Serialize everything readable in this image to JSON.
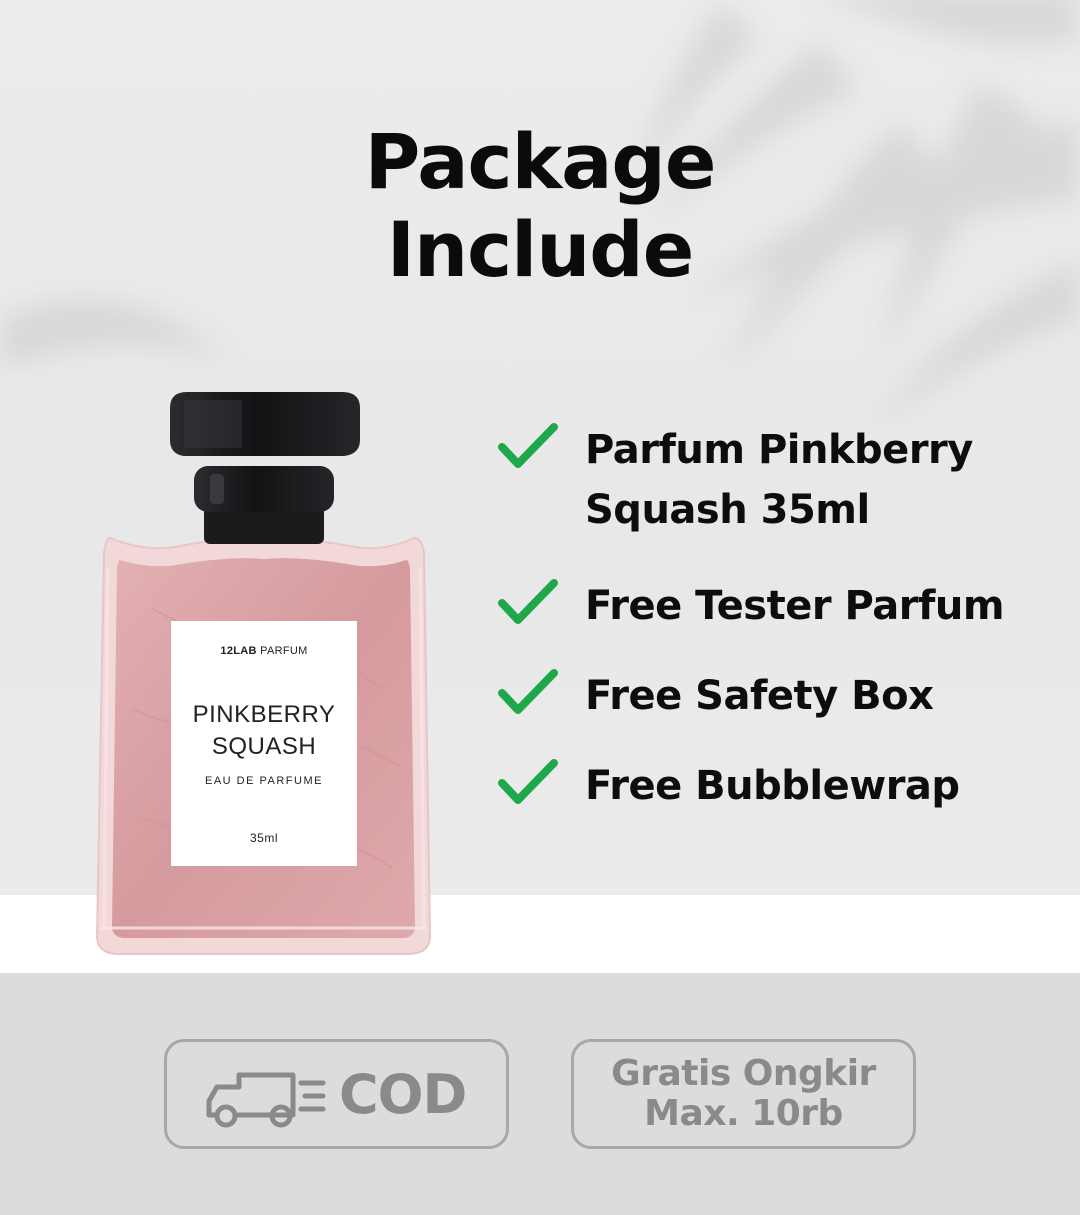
{
  "heading": {
    "line1": "Package",
    "line2": "Include"
  },
  "product_label": {
    "brand_bold": "12LAB",
    "brand_light": "PARFUM",
    "name_line1": "PINKBERRY",
    "name_line2": "SQUASH",
    "type": "EAU DE PARFUME",
    "size": "35ml"
  },
  "package_items": [
    {
      "line1": "Parfum Pinkberry",
      "line2": "Squash 35ml"
    },
    {
      "line1": "Free Tester Parfum"
    },
    {
      "line1": "Free Safety Box"
    },
    {
      "line1": "Free Bubblewrap"
    }
  ],
  "badges": {
    "cod": {
      "label": "COD",
      "icon": "delivery-truck-icon"
    },
    "shipping": {
      "line1": "Gratis Ongkir",
      "line2": "Max. 10rb"
    }
  },
  "colors": {
    "check": "#1fa84a",
    "badge_text": "#8a8a8a",
    "liquid": "#d9a0a3",
    "cap": "#1c1c1f"
  }
}
